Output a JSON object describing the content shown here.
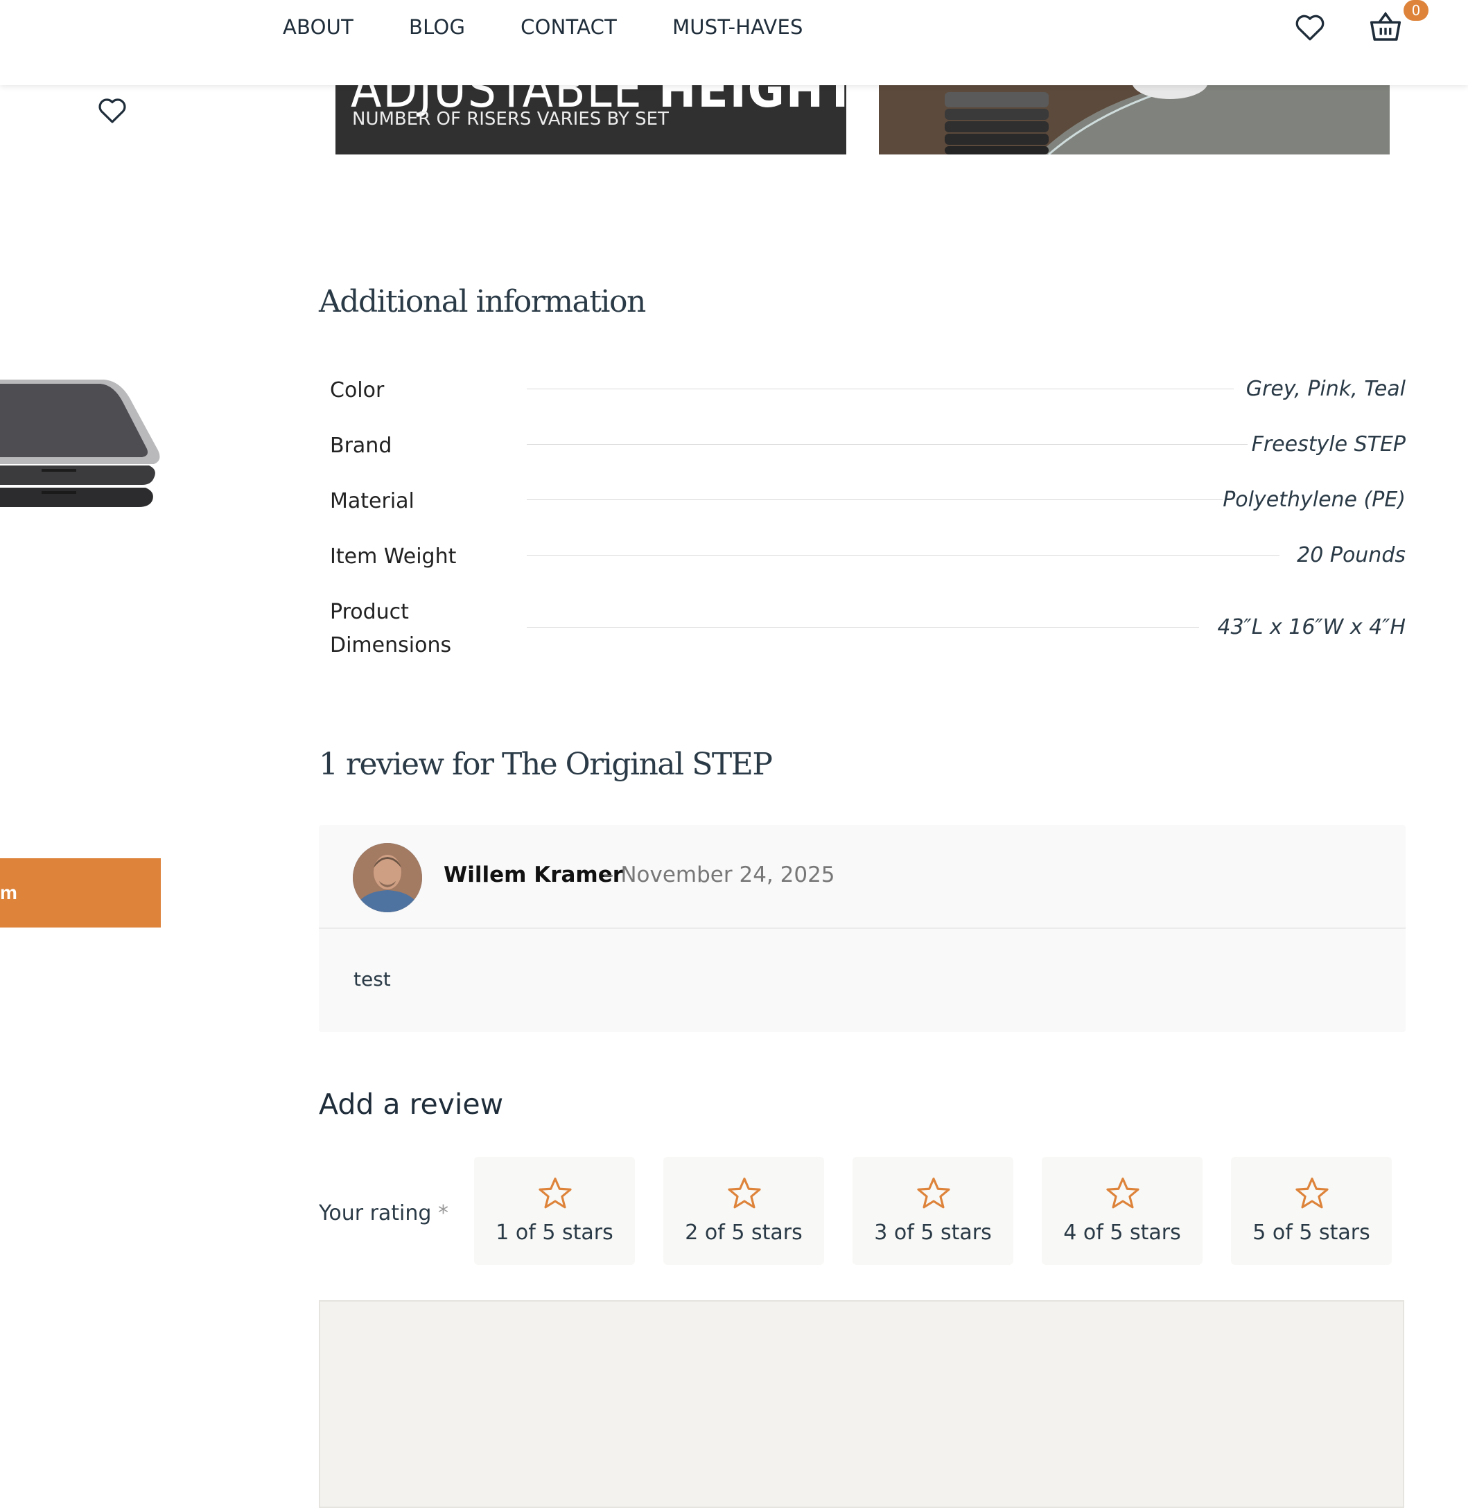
{
  "nav": {
    "items": [
      "ABOUT",
      "BLOG",
      "CONTACT",
      "MUST-HAVES"
    ],
    "cart_count": "0"
  },
  "banner": {
    "title_light": "ADJUSTABLE",
    "title_bold": "HEIGHT",
    "subtitle": "NUMBER OF RISERS VARIES BY SET"
  },
  "left_cta": {
    "label": "m"
  },
  "additional_info": {
    "title": "Additional information",
    "rows": [
      {
        "label": "Color",
        "value": "Grey, Pink, Teal"
      },
      {
        "label": "Brand",
        "value": "Freestyle STEP"
      },
      {
        "label": "Material",
        "value": "Polyethylene (PE)"
      },
      {
        "label": "Item Weight",
        "value": "20 Pounds"
      },
      {
        "label": "Product Dimensions",
        "label_line1": "Product",
        "label_line2": "Dimensions",
        "value": "43″L x 16″W x 4″H"
      }
    ]
  },
  "reviews": {
    "title": "1 review for The Original STEP",
    "items": [
      {
        "author": "Willem Kramer",
        "date": "– November 24, 2025",
        "text": "test"
      }
    ]
  },
  "add_review": {
    "title": "Add a review",
    "rating_label": "Your rating",
    "required_mark": "*",
    "stars": [
      "1 of 5 stars",
      "2 of 5 stars",
      "3 of 5 stars",
      "4 of 5 stars",
      "5 of 5 stars"
    ]
  },
  "colors": {
    "accent": "#dd833a",
    "text": "#1f2d3a"
  }
}
